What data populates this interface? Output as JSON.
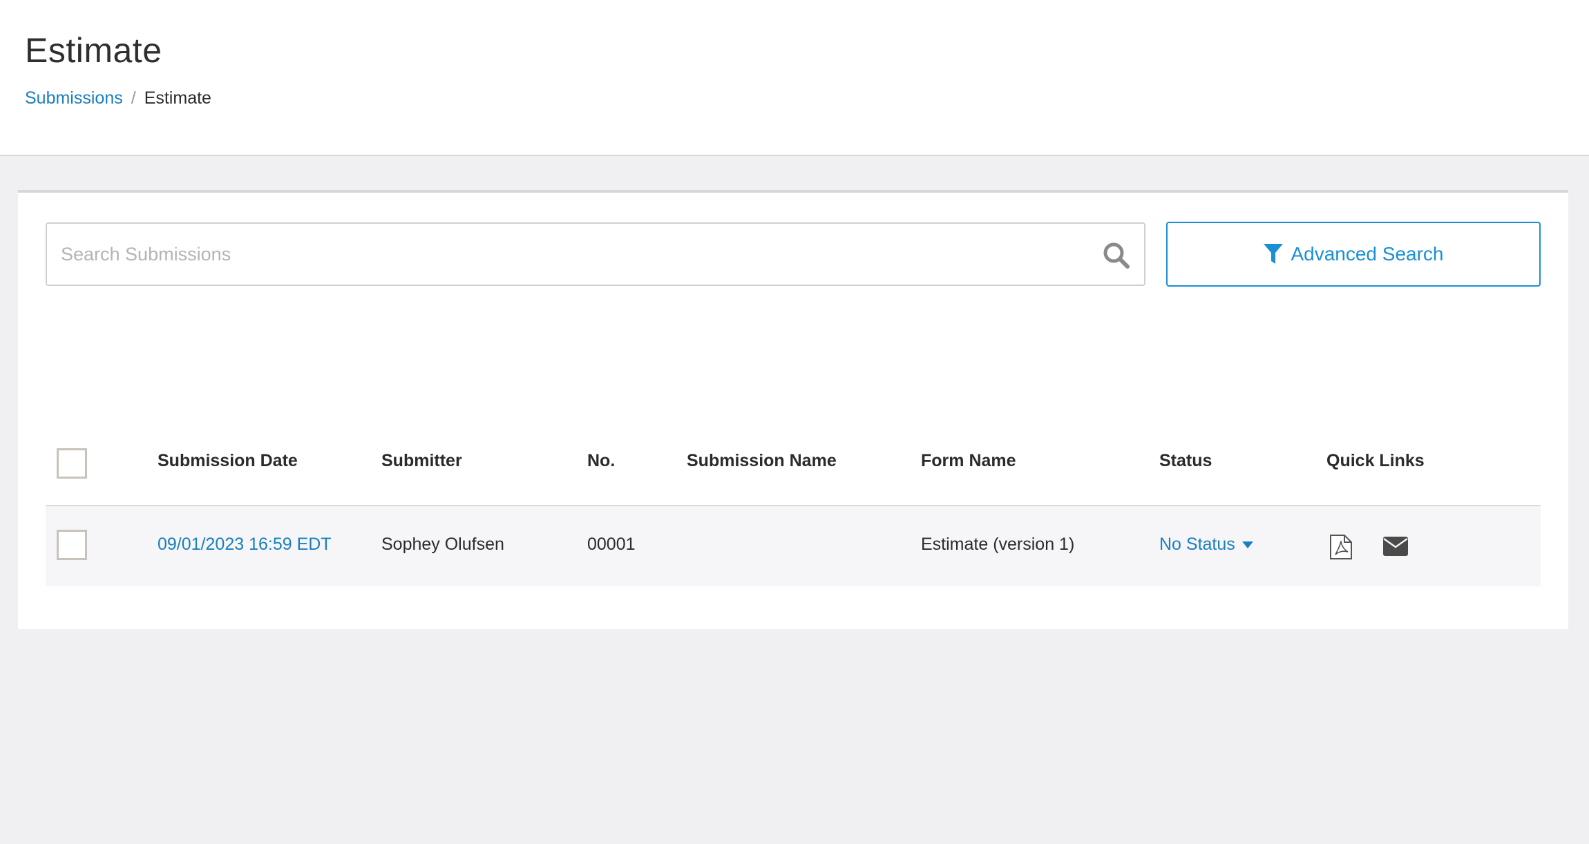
{
  "header": {
    "title": "Estimate",
    "breadcrumb": {
      "parent": "Submissions",
      "separator": "/",
      "current": "Estimate"
    }
  },
  "search": {
    "placeholder": "Search Submissions",
    "value": "",
    "icon": "search-icon"
  },
  "advanced_search": {
    "label": "Advanced Search",
    "icon": "filter-icon"
  },
  "table": {
    "columns": {
      "submission_date": "Submission Date",
      "submitter": "Submitter",
      "number": "No.",
      "submission_name": "Submission Name",
      "form_name": "Form Name",
      "status": "Status",
      "quick_links": "Quick Links"
    },
    "rows": [
      {
        "submission_date": "09/01/2023 16:59 EDT",
        "submitter": "Sophey Olufsen",
        "number": "00001",
        "submission_name": "",
        "form_name": "Estimate (version 1)",
        "status": "No Status",
        "quick_links": [
          "pdf-icon",
          "mail-icon"
        ]
      }
    ]
  },
  "colors": {
    "accent": "#1a8fd6",
    "link": "#1a7fbf",
    "background": "#f0f0f3"
  }
}
